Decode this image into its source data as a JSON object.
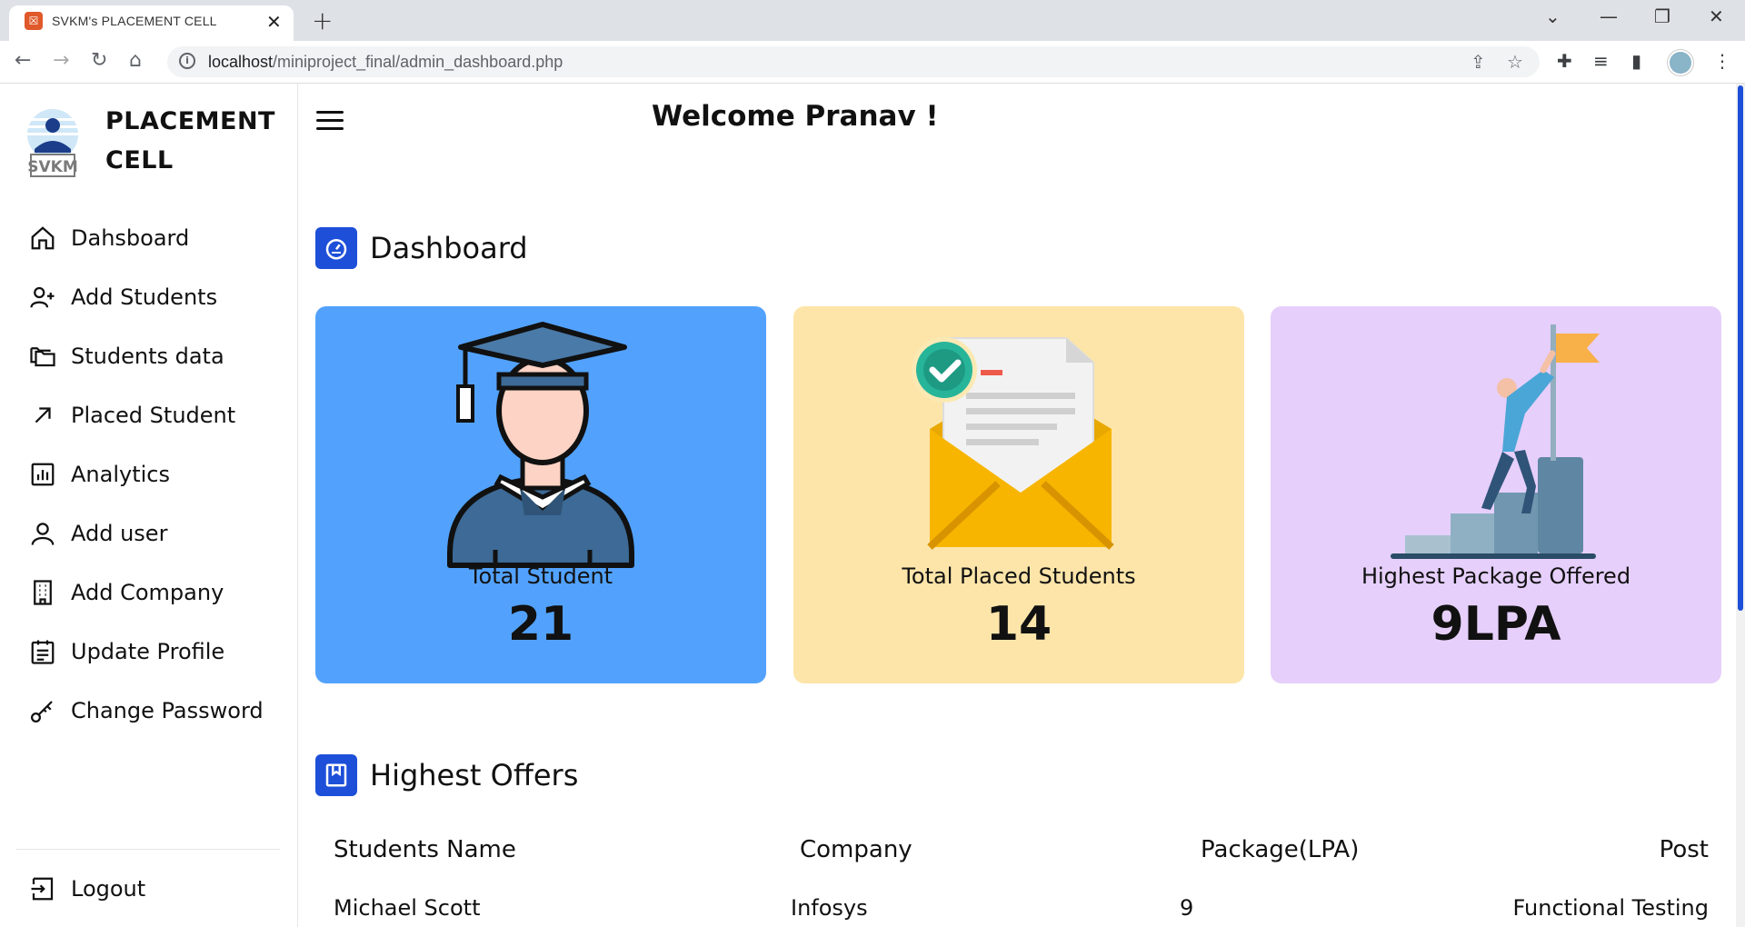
{
  "browser": {
    "tab_title": "SVKM's PLACEMENT CELL",
    "url_host": "localhost",
    "url_path": "/miniproject_final/admin_dashboard.php"
  },
  "sidebar": {
    "brand_line1": "PLACEMENT",
    "brand_line2": "CELL",
    "items": [
      {
        "label": "Dahsboard",
        "icon": "home-icon"
      },
      {
        "label": "Add Students",
        "icon": "user-plus-icon"
      },
      {
        "label": "Students data",
        "icon": "folders-icon"
      },
      {
        "label": "Placed Student",
        "icon": "arrow-up-right-icon"
      },
      {
        "label": "Analytics",
        "icon": "bar-chart-icon"
      },
      {
        "label": "Add user",
        "icon": "user-icon"
      },
      {
        "label": "Add Company",
        "icon": "building-icon"
      },
      {
        "label": "Update Profile",
        "icon": "calendar-list-icon"
      },
      {
        "label": "Change Password",
        "icon": "key-icon"
      }
    ],
    "logout_label": "Logout"
  },
  "header": {
    "welcome": "Welcome Pranav !"
  },
  "dashboard": {
    "title": "Dashboard",
    "cards": [
      {
        "label": "Total Student",
        "value": "21",
        "bg": "#52a2fd"
      },
      {
        "label": "Total Placed Students",
        "value": "14",
        "bg": "#fde5a9"
      },
      {
        "label": "Highest Package Offered",
        "value": "9LPA",
        "bg": "#e6cffb"
      }
    ]
  },
  "offers": {
    "title": "Highest Offers",
    "columns": [
      "Students Name",
      "Company",
      "Package(LPA)",
      "Post"
    ],
    "rows": [
      [
        "Michael Scott",
        "Infosys",
        "9",
        "Functional Testing"
      ]
    ]
  },
  "colors": {
    "accent": "#1d4fd8"
  }
}
